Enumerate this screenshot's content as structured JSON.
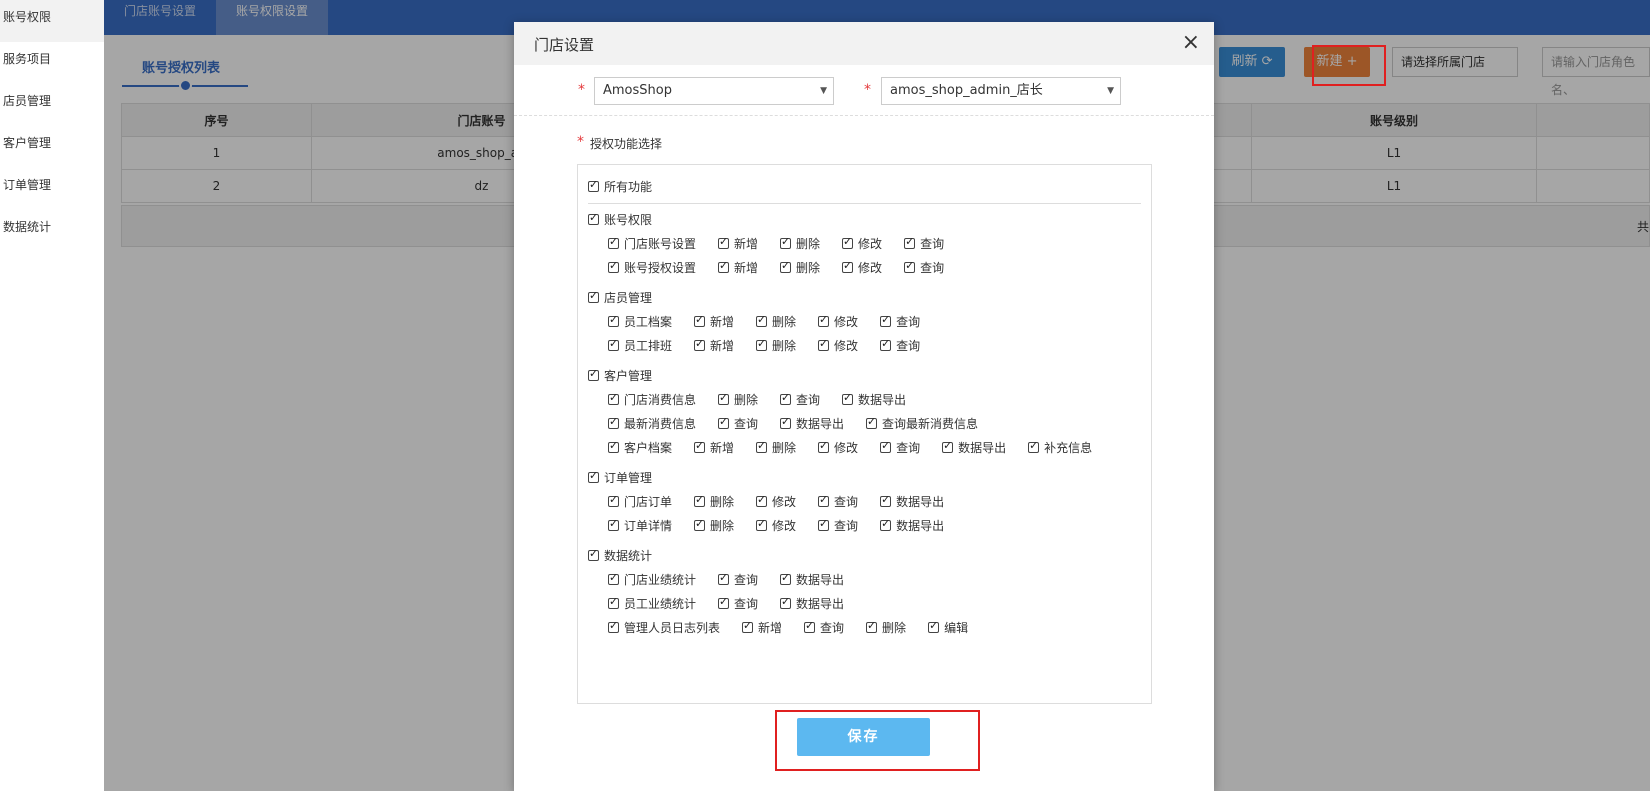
{
  "sidebar": {
    "items": [
      {
        "label": "账号权限"
      },
      {
        "label": "服务项目"
      },
      {
        "label": "店员管理"
      },
      {
        "label": "客户管理"
      },
      {
        "label": "订单管理"
      },
      {
        "label": "数据统计"
      }
    ]
  },
  "topbar": {
    "tabs": [
      {
        "label": "门店账号设置"
      },
      {
        "label": "账号权限设置"
      }
    ]
  },
  "list": {
    "title": "账号授权列表",
    "refresh_label": "刷新",
    "new_label": "新建",
    "store_select_placeholder": "请选择所属门店",
    "search_placeholder": "请输入门店角色名、"
  },
  "table": {
    "headers": [
      "序号",
      "门店账号",
      "账号级别"
    ],
    "rows": [
      {
        "index": "1",
        "account": "amos_shop_ad",
        "level": "L1"
      },
      {
        "index": "2",
        "account": "dz",
        "level": "L1"
      }
    ],
    "footer_text": "共"
  },
  "modal": {
    "title": "门店设置",
    "store_value": "AmosShop",
    "role_value": "amos_shop_admin_店长",
    "perm_label": "授权功能选择",
    "all_label": "所有功能",
    "save_label": "保存",
    "groups": [
      {
        "label": "账号权限",
        "rows": [
          [
            "门店账号设置",
            "新增",
            "删除",
            "修改",
            "查询"
          ],
          [
            "账号授权设置",
            "新增",
            "删除",
            "修改",
            "查询"
          ]
        ]
      },
      {
        "label": "店员管理",
        "rows": [
          [
            "员工档案",
            "新增",
            "删除",
            "修改",
            "查询"
          ],
          [
            "员工排班",
            "新增",
            "删除",
            "修改",
            "查询"
          ]
        ]
      },
      {
        "label": "客户管理",
        "rows": [
          [
            "门店消费信息",
            "删除",
            "查询",
            "数据导出"
          ],
          [
            "最新消费信息",
            "查询",
            "数据导出",
            "查询最新消费信息"
          ],
          [
            "客户档案",
            "新增",
            "删除",
            "修改",
            "查询",
            "数据导出",
            "补充信息"
          ]
        ]
      },
      {
        "label": "订单管理",
        "rows": [
          [
            "门店订单",
            "删除",
            "修改",
            "查询",
            "数据导出"
          ],
          [
            "订单详情",
            "删除",
            "修改",
            "查询",
            "数据导出"
          ]
        ]
      },
      {
        "label": "数据统计",
        "rows": [
          [
            "门店业绩统计",
            "查询",
            "数据导出"
          ],
          [
            "员工业绩统计",
            "查询",
            "数据导出"
          ],
          [
            "管理人员日志列表",
            "新增",
            "查询",
            "删除",
            "编辑"
          ]
        ]
      }
    ]
  },
  "colors": {
    "primary_blue": "#3a6fc8",
    "new_button": "#f0843c",
    "refresh_button": "#3a8fd9",
    "save_button": "#5cb8f0",
    "annotation_red": "#e02020"
  }
}
